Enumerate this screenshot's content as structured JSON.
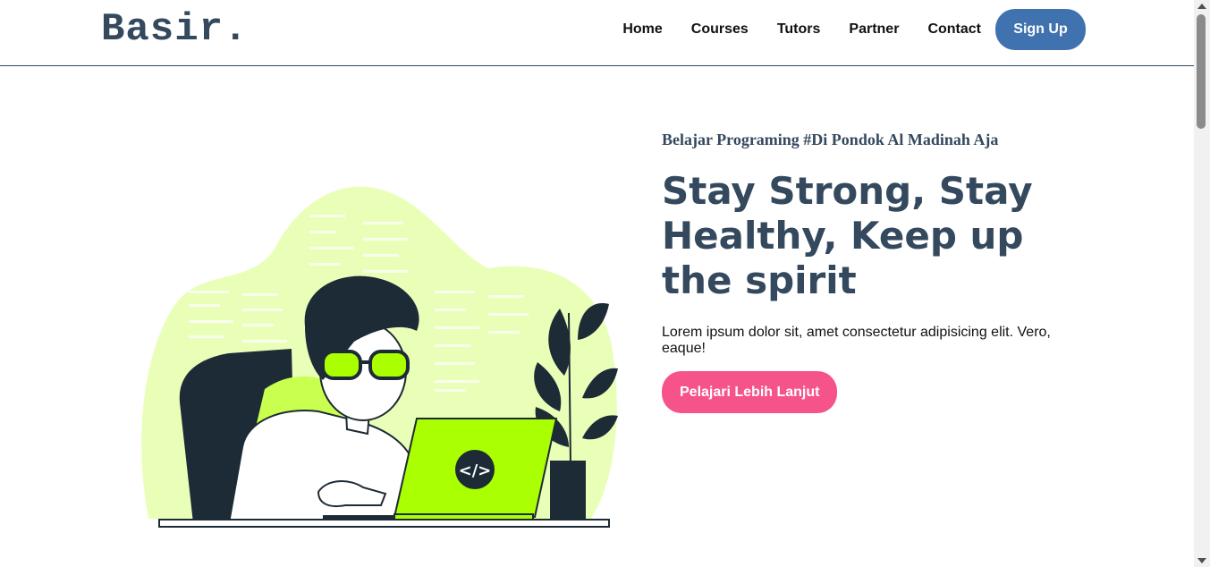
{
  "header": {
    "logo": "Basir.",
    "nav": [
      "Home",
      "Courses",
      "Tutors",
      "Partner",
      "Contact"
    ],
    "signup_label": "Sign Up"
  },
  "hero": {
    "tagline": "Belajar Programing #Di Pondok Al Madinah Aja",
    "headline": "Stay Strong, Stay Healthy, Keep up the spirit",
    "description": "Lorem ipsum dolor sit, amet consectetur adipisicing elit. Vero, eaque!",
    "cta_label": "Pelajari Lebih Lanjut",
    "laptop_symbol": "</>"
  },
  "colors": {
    "primary": "#34495e",
    "signup": "#3f72af",
    "cta": "#f6538a",
    "accent_green": "#aaff00",
    "blob": "#e9ffb8"
  },
  "icons": {
    "hero_illustration": "programmer-at-laptop-illustration",
    "laptop_logo": "code-icon"
  }
}
